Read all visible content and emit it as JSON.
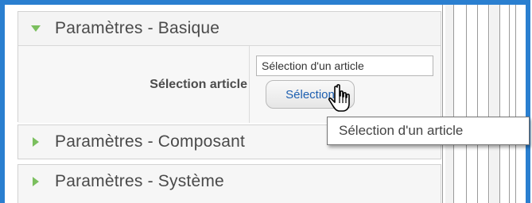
{
  "panels": {
    "basique": {
      "title": "Paramètres - Basique",
      "expanded": true
    },
    "composant": {
      "title": "Paramètres - Composant",
      "expanded": false
    },
    "systeme": {
      "title": "Paramètres - Système",
      "expanded": false
    }
  },
  "field": {
    "label": "Sélection article",
    "input_value": "Sélection d'un article",
    "button_label": "Sélection"
  },
  "tooltip": {
    "text": "Sélection d'un article"
  },
  "colors": {
    "accent_arrow": "#7bbf5e",
    "frame": "#2a7fd0",
    "button_text": "#1d5fb0"
  },
  "icons": {
    "expanded": "triangle-down-icon",
    "collapsed": "triangle-right-icon",
    "cursor": "hand-pointer-icon"
  }
}
